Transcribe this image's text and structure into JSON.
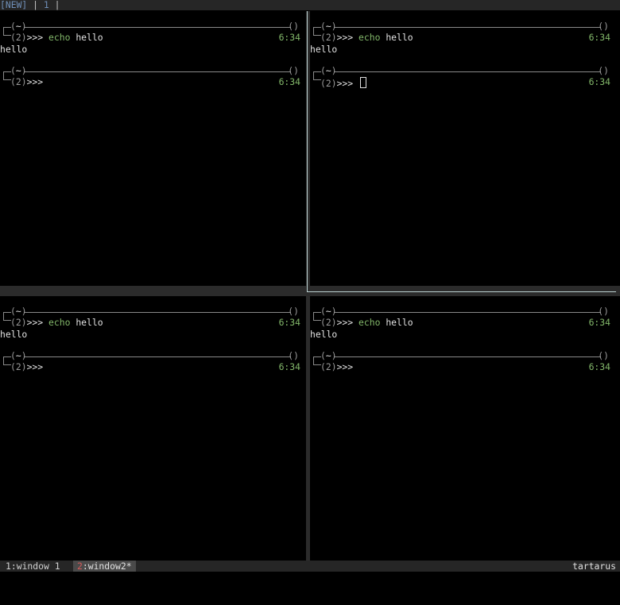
{
  "topbar": {
    "new_tag": "[NEW]",
    "sep": " | ",
    "tab": "1",
    "end": " |"
  },
  "panes": [
    {
      "id": "top-left",
      "prompt1": {
        "tilde": "~",
        "num": "2",
        "cmd": "echo",
        "arg": "hello",
        "time": "6:34"
      },
      "output": "hello",
      "prompt2": {
        "tilde": "~",
        "num": "2",
        "time": "6:34"
      }
    },
    {
      "id": "top-right",
      "prompt1": {
        "tilde": "~",
        "num": "2",
        "cmd": "echo",
        "arg": "hello",
        "time": "6:34"
      },
      "output": "hello",
      "prompt2": {
        "tilde": "~",
        "num": "2",
        "time": "6:34"
      }
    },
    {
      "id": "bottom-left",
      "prompt1": {
        "tilde": "~",
        "num": "2",
        "cmd": "echo",
        "arg": "hello",
        "time": "6:34"
      },
      "output": "hello",
      "prompt2": {
        "tilde": "~",
        "num": "2",
        "time": "6:34"
      }
    },
    {
      "id": "bottom-right",
      "prompt1": {
        "tilde": "~",
        "num": "2",
        "cmd": "echo",
        "arg": "hello",
        "time": "6:34"
      },
      "output": "hello",
      "prompt2": {
        "tilde": "~",
        "num": "2",
        "time": "6:34"
      }
    }
  ],
  "prompt_symbol": ">>>",
  "status": {
    "window1": "1:window 1",
    "window2_index": "2",
    "window2_name": ":window2*",
    "hostname": "tartarus"
  },
  "colors": {
    "command": "#83b86a",
    "time": "#83b86a",
    "active_window_index": "#d35a5a",
    "tabbar": "#262626"
  }
}
